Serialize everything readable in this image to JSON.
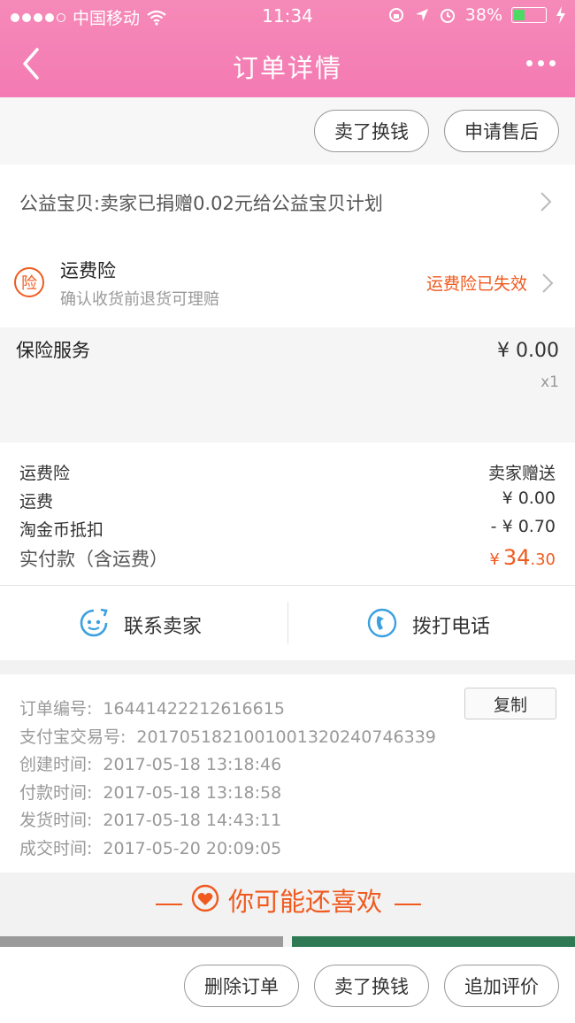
{
  "status_bar": {
    "carrier": "中国移动",
    "time": "11:34",
    "battery": "38%"
  },
  "nav": {
    "title": "订单详情"
  },
  "top_actions": {
    "sell_label": "卖了换钱",
    "after_sale_label": "申请售后"
  },
  "charity": {
    "text": "公益宝贝:卖家已捐赠0.02元给公益宝贝计划"
  },
  "insurance": {
    "badge": "险",
    "title": "运费险",
    "subtitle": "确认收货前退货可理赔",
    "status": "运费险已失效"
  },
  "item": {
    "name": "保险服务",
    "price": "¥ 0.00",
    "qty": "x1"
  },
  "summary": {
    "rows": [
      {
        "label": "运费险",
        "value": "卖家赠送"
      },
      {
        "label": "运费",
        "value": "¥ 0.00"
      },
      {
        "label": "淘金币抵扣",
        "value": "- ¥ 0.70"
      }
    ],
    "total_label": "实付款（含运费）",
    "total_currency": "¥",
    "total_int": "34",
    "total_dec": ".30"
  },
  "contact": {
    "seller_label": "联系卖家",
    "phone_label": "拨打电话"
  },
  "order_info": {
    "copy_label": "复制",
    "lines": [
      {
        "label": "订单编号:",
        "value": "16441422212616615"
      },
      {
        "label": "支付宝交易号:",
        "value": "2017051821001001320240746339"
      },
      {
        "label": "创建时间:",
        "value": "2017-05-18 13:18:46"
      },
      {
        "label": "付款时间:",
        "value": "2017-05-18 13:18:58"
      },
      {
        "label": "发货时间:",
        "value": "2017-05-18 14:43:11"
      },
      {
        "label": "成交时间:",
        "value": "2017-05-20 20:09:05"
      }
    ]
  },
  "recommend": {
    "title": "你可能还喜欢"
  },
  "bottom_actions": {
    "delete_label": "删除订单",
    "sell_label": "卖了换钱",
    "review_label": "追加评价"
  },
  "colors": {
    "brand_pink": "#f47ab3",
    "accent_orange": "#f05a1e",
    "contact_blue": "#3aa0e0"
  }
}
